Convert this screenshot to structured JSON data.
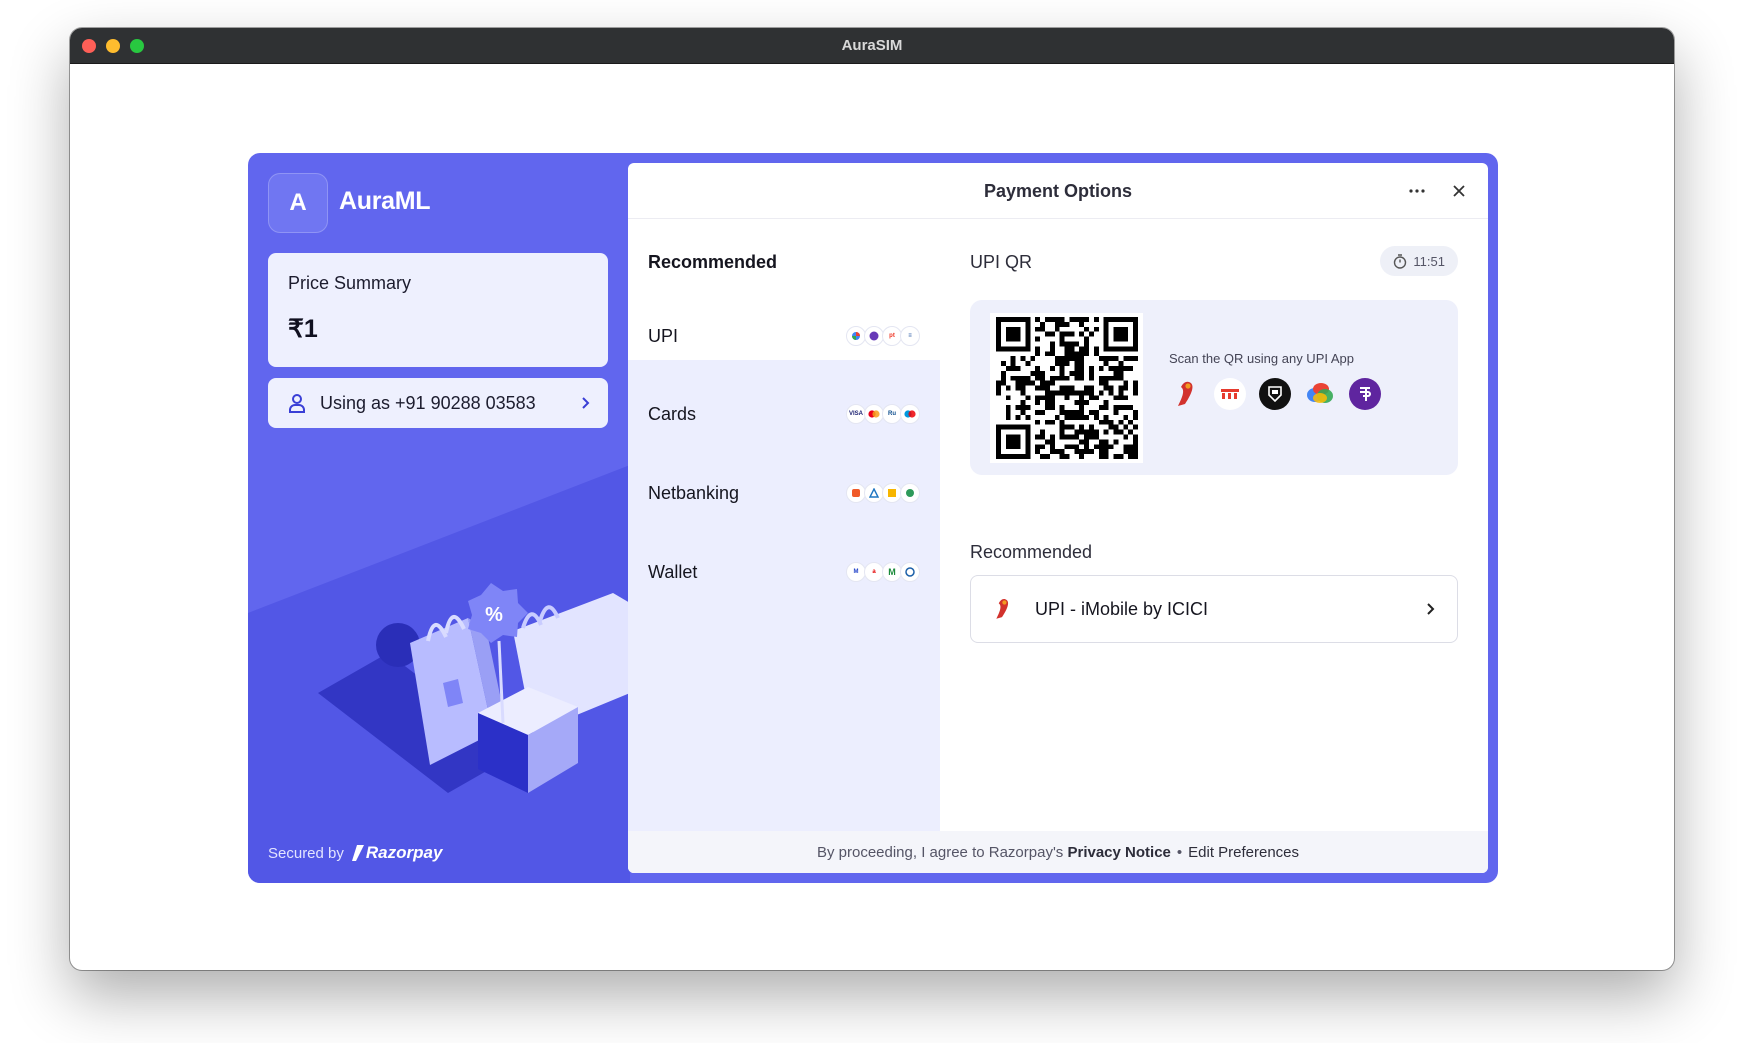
{
  "window": {
    "title": "AuraSIM"
  },
  "merchant": {
    "initial": "A",
    "name": "AuraML"
  },
  "price_summary": {
    "label": "Price Summary",
    "amount": "₹1"
  },
  "user": {
    "text": "Using as +91 90288 03583"
  },
  "secured": {
    "label": "Secured by",
    "brand": "Razorpay"
  },
  "payment": {
    "title": "Payment Options",
    "nav_heading": "Recommended",
    "methods": [
      {
        "label": "UPI",
        "icons": [
          "gpay-icon",
          "phonepe-icon",
          "paytm-icon",
          "bhim-icon"
        ]
      },
      {
        "label": "Cards",
        "icons": [
          "visa-icon",
          "mastercard-icon",
          "rupay-icon",
          "maestro-icon"
        ]
      },
      {
        "label": "Netbanking",
        "icons": [
          "bank-1-icon",
          "bank-2-icon",
          "bank-3-icon",
          "bank-4-icon"
        ]
      },
      {
        "label": "Wallet",
        "icons": [
          "mobikwik-icon",
          "airtel-icon",
          "m-wallet-icon",
          "wallet-4-icon"
        ]
      }
    ],
    "qr": {
      "heading": "UPI QR",
      "timer": "11:51",
      "scan_text": "Scan the QR using any UPI App",
      "apps": [
        "imobile-icon",
        "paytm-icon",
        "cred-icon",
        "gpay-icon",
        "phonepe-icon"
      ]
    },
    "recommended": {
      "heading": "Recommended",
      "item_label": "UPI - iMobile by ICICI"
    },
    "footer": {
      "prefix": "By proceeding, I agree to Razorpay's",
      "privacy": "Privacy Notice",
      "separator": "•",
      "prefs": "Edit Preferences"
    }
  },
  "colors": {
    "brand": "#6166ee",
    "panel_light": "#eceefe",
    "accent_dark": "#3a3fd6"
  }
}
